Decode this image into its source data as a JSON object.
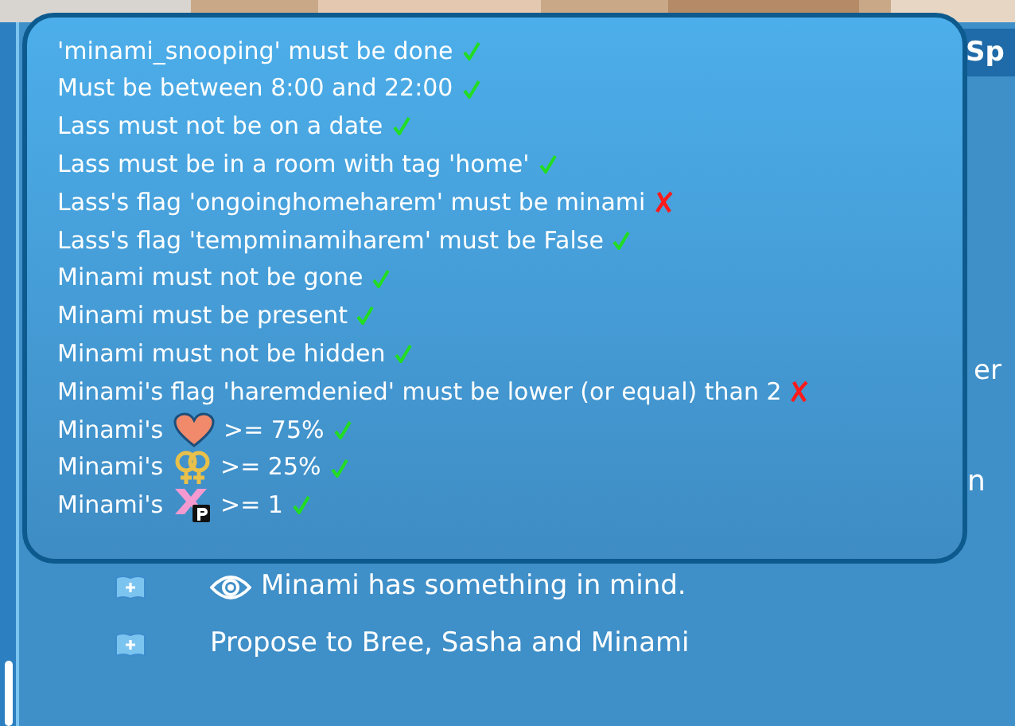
{
  "background_labels": {
    "top_right": "Sp",
    "middle_right": "er",
    "lower_right": "n"
  },
  "tooltip": {
    "conditions": [
      {
        "kind": "text",
        "text": "'minami_snooping' must be done",
        "met": true
      },
      {
        "kind": "text",
        "text": "Must be between 8:00 and 22:00",
        "met": true
      },
      {
        "kind": "text",
        "text": "Lass must not be on a date",
        "met": true
      },
      {
        "kind": "text",
        "text": "Lass must be in a room with tag 'home'",
        "met": true
      },
      {
        "kind": "text",
        "text": "Lass's flag 'ongoinghomeharem' must be minami",
        "met": false
      },
      {
        "kind": "text",
        "text": "Lass's flag 'tempminamiharem' must be False",
        "met": true
      },
      {
        "kind": "text",
        "text": "Minami must not be gone",
        "met": true
      },
      {
        "kind": "text",
        "text": "Minami must be present",
        "met": true
      },
      {
        "kind": "text",
        "text": "Minami must not be hidden",
        "met": true
      },
      {
        "kind": "text",
        "text": "Minami's flag 'haremdenied' must be lower (or equal) than 2",
        "met": false
      },
      {
        "kind": "heart",
        "text": "Minami's",
        "after": ">= 75%",
        "met": true
      },
      {
        "kind": "gender",
        "text": "Minami's",
        "after": ">= 25%",
        "met": true
      },
      {
        "kind": "xp",
        "text": "Minami's",
        "after": ">= 1",
        "met": true
      }
    ]
  },
  "actions": [
    {
      "kind": "seen",
      "label": "Minami has something in mind."
    },
    {
      "kind": "plain",
      "label": "Propose to Bree, Sasha and Minami"
    }
  ]
}
